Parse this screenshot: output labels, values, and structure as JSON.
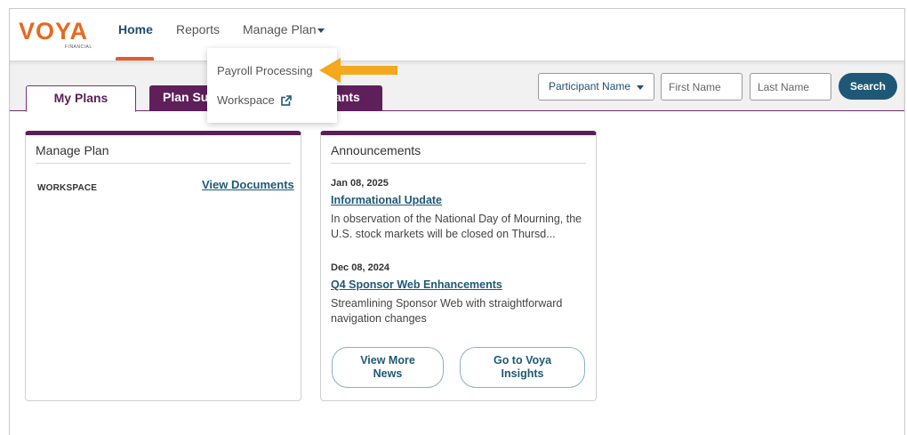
{
  "brand": {
    "logo_text": "VOYA",
    "logo_sub": "FINANCIAL",
    "accent": "#e8681e",
    "primary": "#1f5876",
    "plum": "#5f1f5b"
  },
  "nav": {
    "home": "Home",
    "reports": "Reports",
    "manage_plan": "Manage Plan"
  },
  "dropdown": {
    "items": [
      {
        "label": "Payroll Processing",
        "icon": ""
      },
      {
        "label": "Workspace",
        "icon": "external-link-icon"
      }
    ]
  },
  "tabs": {
    "my_plans": "My Plans",
    "plan_summary": "Plan Su",
    "participants": "ants"
  },
  "search": {
    "select_value": "Participant Name",
    "first_placeholder": "First Name",
    "last_placeholder": "Last Name",
    "button": "Search"
  },
  "manage_card": {
    "title": "Manage Plan",
    "workspace_label": "WORKSPACE",
    "view_documents": "View Documents"
  },
  "announcements": {
    "title": "Announcements",
    "items": [
      {
        "date": "Jan 08, 2025",
        "title": "Informational Update",
        "body": "In observation of the National Day of Mourning, the U.S. stock markets will be closed on Thursd..."
      },
      {
        "date": "Dec 08, 2024",
        "title": "Q4 Sponsor Web Enhancements",
        "body": "Streamlining Sponsor Web with straightforward navigation changes"
      }
    ],
    "view_more_line1": "View More",
    "view_more_line2": "News",
    "insights_line1": "Go to Voya",
    "insights_line2": "Insights"
  }
}
